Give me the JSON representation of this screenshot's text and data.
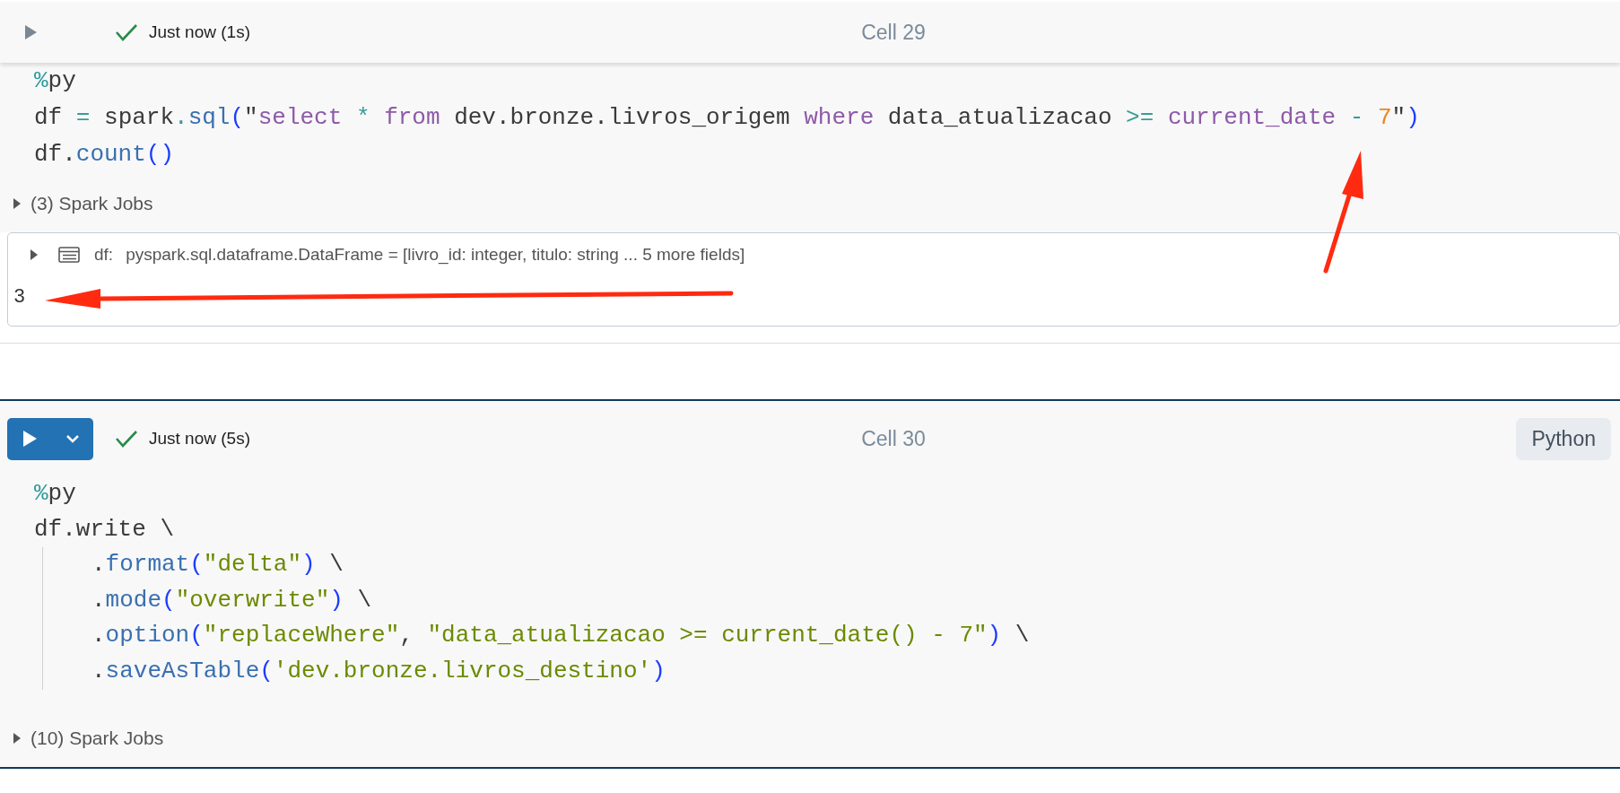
{
  "cells": [
    {
      "kind": "icon",
      "succeeded": true,
      "status_text": "Just now (1s)",
      "cell_label": "Cell 29",
      "selected": false,
      "code": [
        {
          "tokens": [
            {
              "kind": "magic",
              "text": "%"
            },
            {
              "kind": "plain",
              "text": "py"
            }
          ]
        },
        {
          "tokens": [
            {
              "kind": "plain",
              "text": "df"
            },
            {
              "kind": "op",
              "text": " = "
            },
            {
              "kind": "plain",
              "text": "spark"
            },
            {
              "kind": "op",
              "text": "."
            },
            {
              "kind": "func",
              "text": "sql"
            },
            {
              "kind": "paren",
              "text": "("
            },
            {
              "kind": "plain",
              "text": "\""
            },
            {
              "kind": "kw",
              "text": "select"
            },
            {
              "kind": "op",
              "text": " * "
            },
            {
              "kind": "kw",
              "text": "from"
            },
            {
              "kind": "plain",
              "text": " dev.bronze.livros_origem "
            },
            {
              "kind": "kw",
              "text": "where"
            },
            {
              "kind": "plain",
              "text": " data_atualizacao "
            },
            {
              "kind": "op",
              "text": ">= "
            },
            {
              "kind": "kw",
              "text": "current_date"
            },
            {
              "kind": "op",
              "text": " - "
            },
            {
              "kind": "num",
              "text": "7"
            },
            {
              "kind": "plain",
              "text": "\""
            },
            {
              "kind": "paren",
              "text": ")"
            }
          ]
        },
        {
          "tokens": [
            {
              "kind": "plain",
              "text": "df."
            },
            {
              "kind": "func",
              "text": "count"
            },
            {
              "kind": "paren",
              "text": "()"
            }
          ]
        }
      ],
      "spark_jobs": {
        "label": "(3) Spark Jobs",
        "expanded": false
      },
      "output": {
        "schema": {
          "expanded": false,
          "name": "df:",
          "type": "pyspark.sql.dataframe.DataFrame = [livro_id: integer, titulo: string ... 5 more fields]"
        },
        "result": "3"
      }
    },
    {
      "kind": "button",
      "succeeded": true,
      "status_text": "Just now (5s)",
      "cell_label": "Cell 30",
      "language": "Python",
      "selected": true,
      "code": [
        {
          "tokens": [
            {
              "kind": "magic",
              "text": "%"
            },
            {
              "kind": "plain",
              "text": "py"
            }
          ]
        },
        {
          "tokens": [
            {
              "kind": "plain",
              "text": "df.write \\"
            }
          ],
          "children": [
            {
              "tokens": [
                {
                  "kind": "plain",
                  "text": "."
                },
                {
                  "kind": "func",
                  "text": "format"
                },
                {
                  "kind": "paren",
                  "text": "("
                },
                {
                  "kind": "str",
                  "text": "\"delta\""
                },
                {
                  "kind": "paren",
                  "text": ")"
                },
                {
                  "kind": "plain",
                  "text": " \\"
                }
              ]
            },
            {
              "tokens": [
                {
                  "kind": "plain",
                  "text": "."
                },
                {
                  "kind": "func",
                  "text": "mode"
                },
                {
                  "kind": "paren",
                  "text": "("
                },
                {
                  "kind": "str",
                  "text": "\"overwrite\""
                },
                {
                  "kind": "paren",
                  "text": ")"
                },
                {
                  "kind": "plain",
                  "text": " \\"
                }
              ]
            },
            {
              "tokens": [
                {
                  "kind": "plain",
                  "text": "."
                },
                {
                  "kind": "func",
                  "text": "option"
                },
                {
                  "kind": "paren",
                  "text": "("
                },
                {
                  "kind": "str",
                  "text": "\"replaceWhere\""
                },
                {
                  "kind": "plain",
                  "text": ", "
                },
                {
                  "kind": "str",
                  "text": "\"data_atualizacao >= current_date() - 7\""
                },
                {
                  "kind": "paren",
                  "text": ")"
                },
                {
                  "kind": "plain",
                  "text": " \\"
                }
              ]
            },
            {
              "tokens": [
                {
                  "kind": "plain",
                  "text": "."
                },
                {
                  "kind": "func",
                  "text": "saveAsTable"
                },
                {
                  "kind": "paren",
                  "text": "("
                },
                {
                  "kind": "str",
                  "text": "'dev.bronze.livros_destino'"
                },
                {
                  "kind": "paren",
                  "text": ")"
                }
              ]
            }
          ]
        }
      ],
      "spark_jobs": {
        "label": "(10) Spark Jobs",
        "expanded": false
      }
    }
  ]
}
